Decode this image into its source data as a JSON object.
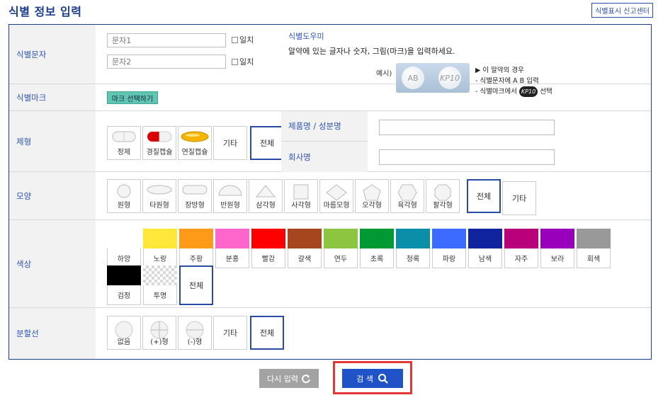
{
  "header": {
    "title": "식별 정보 입력",
    "report_link": "식별표시 신고센터"
  },
  "ident": {
    "label": "식별문자",
    "input1_placeholder": "문자1",
    "input2_placeholder": "문자2",
    "exact_label": "일치",
    "helper_title": "식별도우미",
    "helper_desc": "알약에 있는 글자나 숫자, 그림(마크)을 입력하세요.",
    "example_label": "예시)",
    "example_text_1": "AB",
    "example_text_2": "KP10",
    "note1": "▶ 이 알약의 경우",
    "note2": "- 식별문자에 A B 입력",
    "note3a": "- 식별마크에서",
    "note3_mark": "KP10",
    "note3b": "선택"
  },
  "mark": {
    "label": "식별마크",
    "button": "마크 선택하기"
  },
  "form": {
    "label": "제형",
    "options": [
      "정제",
      "경질캡슐",
      "연질캡슐"
    ],
    "etc": "기타",
    "all": "전체",
    "product_label": "제품명 / 성분명",
    "company_label": "회사명"
  },
  "shape": {
    "label": "모양",
    "options": [
      "원형",
      "타원형",
      "장방형",
      "반원형",
      "삼각형",
      "사각형",
      "마름모형",
      "오각형",
      "육각형",
      "팔각형"
    ],
    "all": "전체",
    "etc": "기타"
  },
  "color": {
    "label": "색상",
    "options": [
      {
        "name": "하양",
        "hex": "#ffffff"
      },
      {
        "name": "노랑",
        "hex": "#ffe83a"
      },
      {
        "name": "주황",
        "hex": "#ff9a18"
      },
      {
        "name": "분홍",
        "hex": "#ff66cc"
      },
      {
        "name": "빨강",
        "hex": "#ff0000"
      },
      {
        "name": "갈색",
        "hex": "#a5461f"
      },
      {
        "name": "연두",
        "hex": "#8cc53f"
      },
      {
        "name": "초록",
        "hex": "#009933"
      },
      {
        "name": "청록",
        "hex": "#0b8fa8"
      },
      {
        "name": "파랑",
        "hex": "#3b6cff"
      },
      {
        "name": "남색",
        "hex": "#10239e"
      },
      {
        "name": "자주",
        "hex": "#b8007a"
      },
      {
        "name": "보라",
        "hex": "#9900bb"
      },
      {
        "name": "회색",
        "hex": "#999999"
      },
      {
        "name": "검정",
        "hex": "#000000"
      },
      {
        "name": "투명",
        "hex": "transparent"
      }
    ],
    "all": "전체"
  },
  "split": {
    "label": "분할선",
    "options": [
      "없음",
      "(+)형",
      "(-)형"
    ],
    "etc": "기타",
    "all": "전체"
  },
  "actions": {
    "reset": "다시 입력",
    "search": "검 색"
  }
}
